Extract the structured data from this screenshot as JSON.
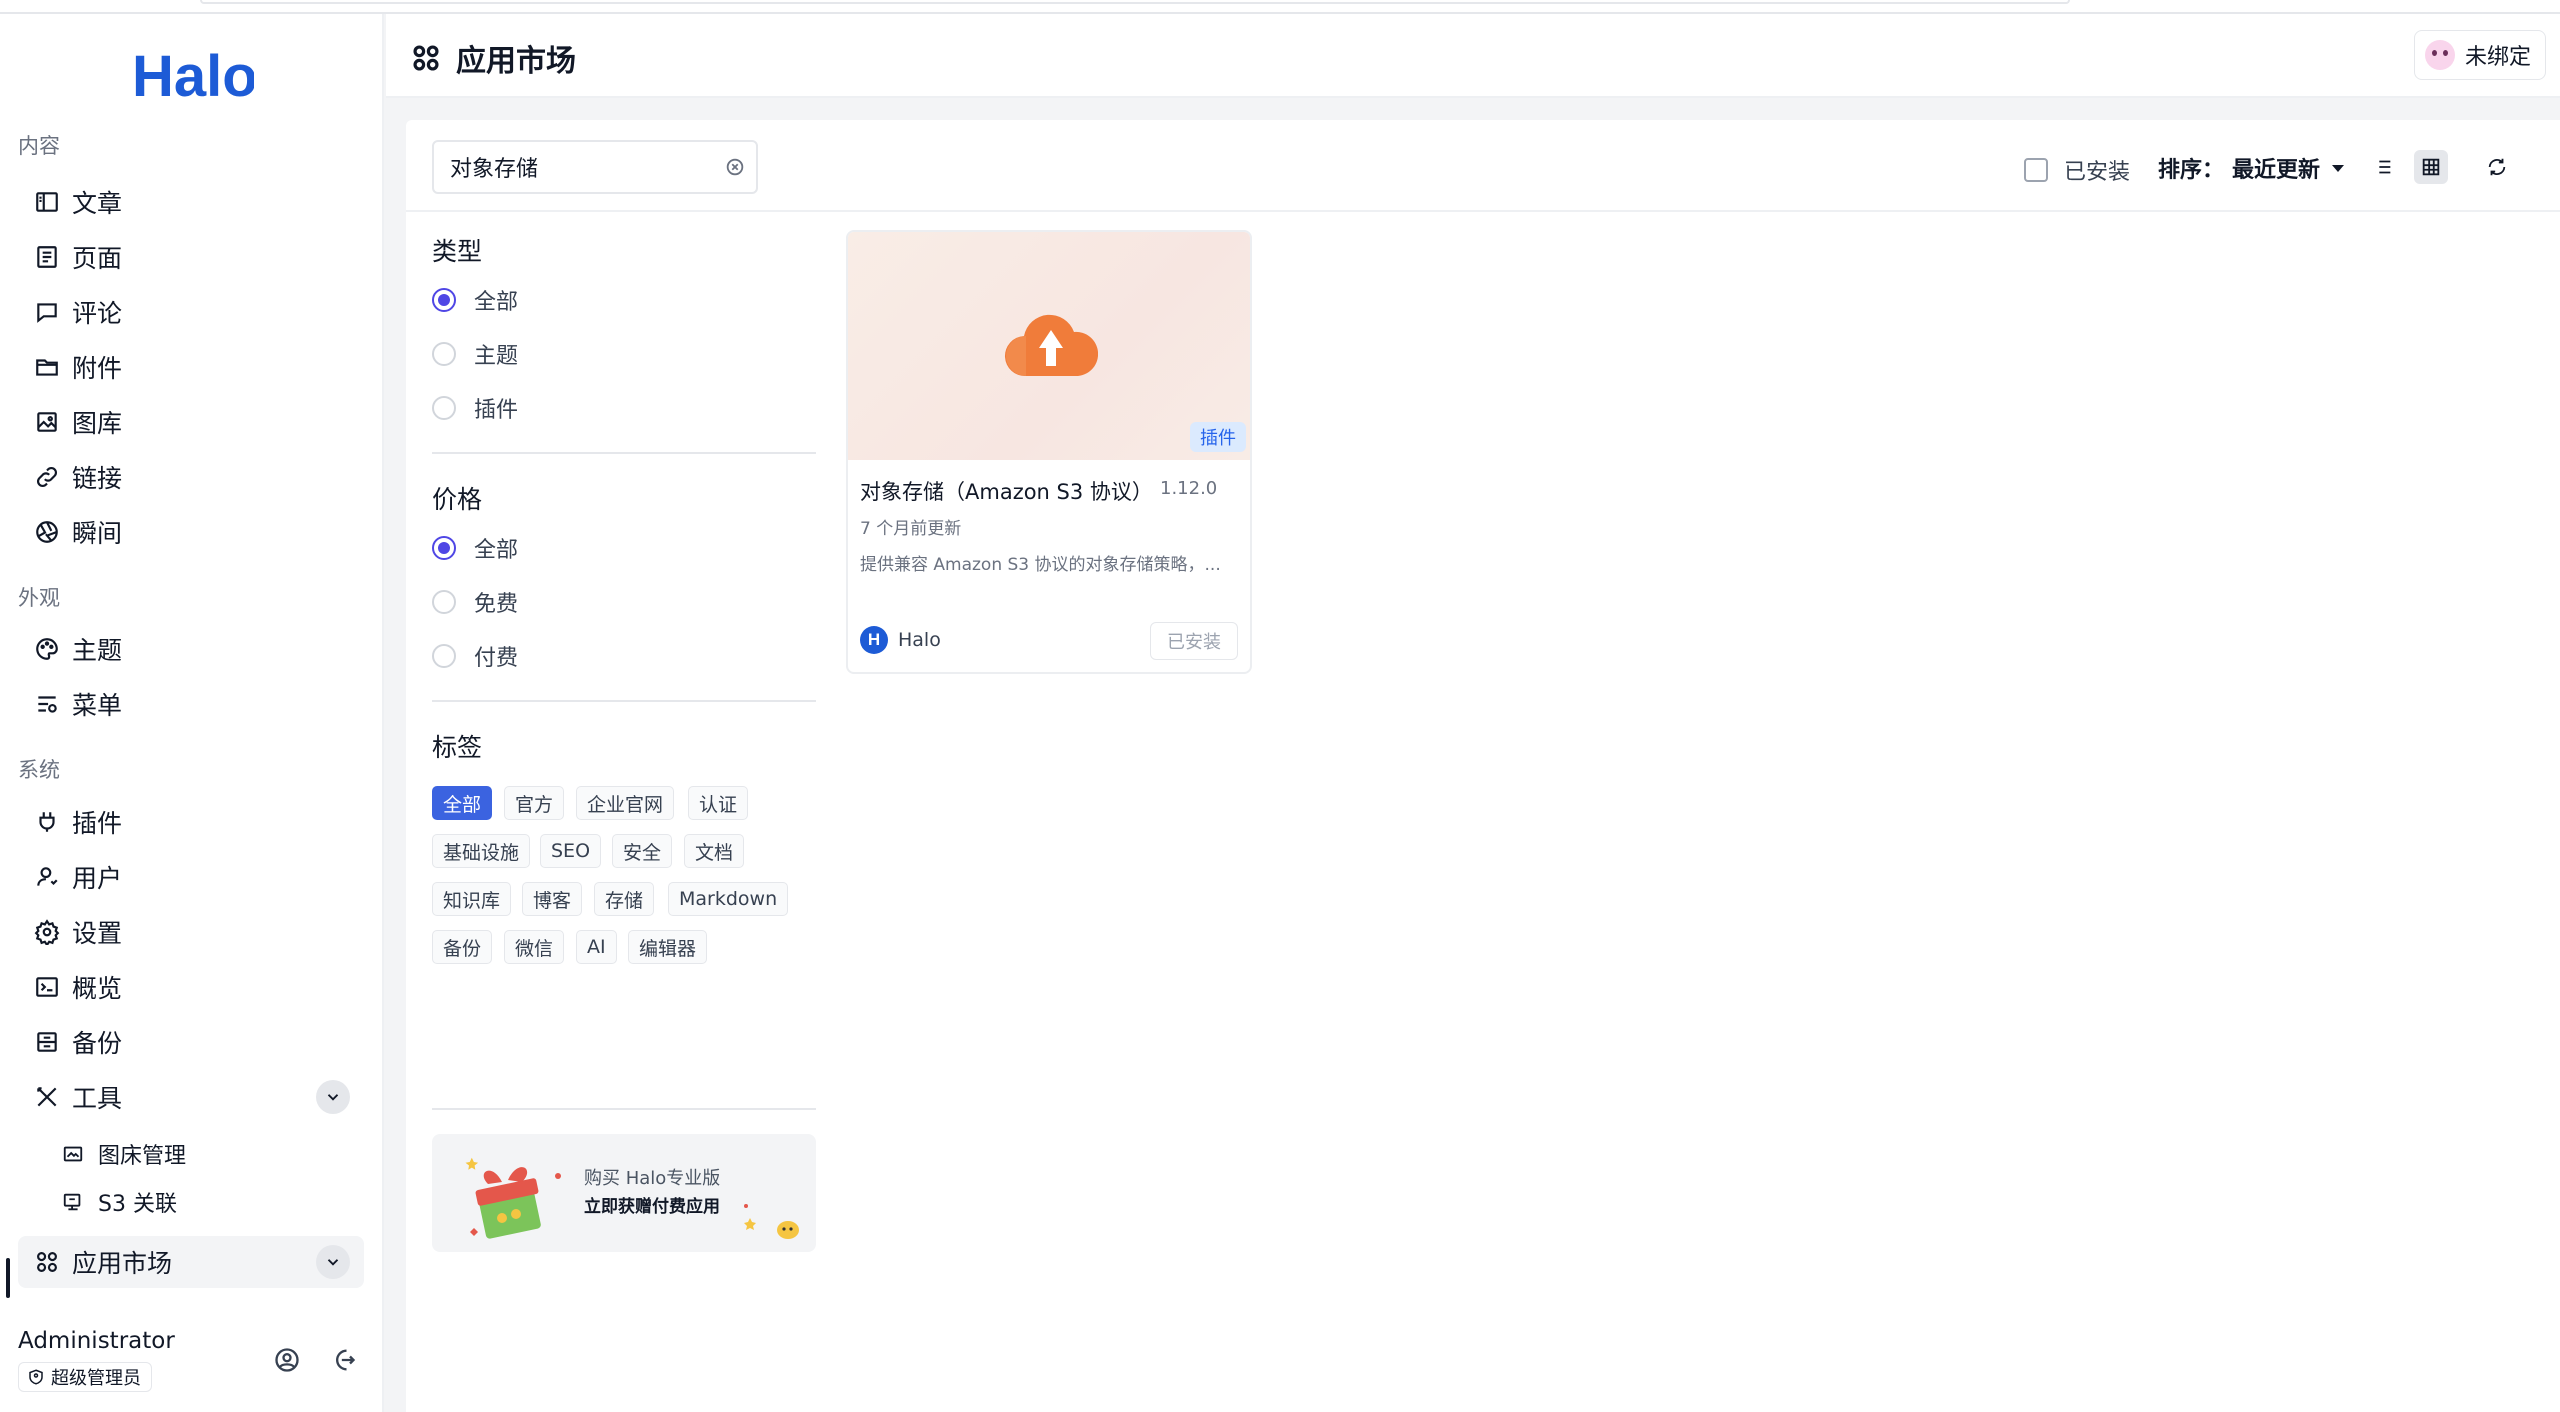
{
  "brand": {
    "logo_text": "Halo",
    "accent": "#1d5bd6"
  },
  "sidebar": {
    "sections": {
      "content": "内容",
      "appearance": "外观",
      "system": "系统"
    },
    "items": {
      "posts": "文章",
      "pages": "页面",
      "comments": "评论",
      "attachments": "附件",
      "gallery": "图库",
      "links": "链接",
      "moments": "瞬间",
      "themes": "主题",
      "menus": "菜单",
      "plugins": "插件",
      "users": "用户",
      "settings": "设置",
      "overview": "概览",
      "backup": "备份",
      "tools": "工具",
      "image_bed": "图床管理",
      "s3_link": "S3 关联",
      "app_market": "应用市场"
    },
    "user": {
      "name": "Administrator",
      "role": "超级管理员"
    }
  },
  "header": {
    "title": "应用市场",
    "bind_label": "未绑定"
  },
  "toolbar": {
    "search_value": "对象存储",
    "installed_label": "已安装",
    "sort_label": "排序：",
    "sort_value": "最近更新"
  },
  "filters": {
    "type": {
      "title": "类型",
      "options": [
        "全部",
        "主题",
        "插件"
      ],
      "selected": "全部"
    },
    "price": {
      "title": "价格",
      "options": [
        "全部",
        "免费",
        "付费"
      ],
      "selected": "全部"
    },
    "tags": {
      "title": "标签",
      "items": [
        "全部",
        "官方",
        "企业官网",
        "认证",
        "基础设施",
        "SEO",
        "安全",
        "文档",
        "知识库",
        "博客",
        "存储",
        "Markdown",
        "备份",
        "微信",
        "AI",
        "编辑器"
      ],
      "selected": "全部"
    },
    "promo": {
      "line1": "购买 Halo专业版",
      "line2": "立即获赠付费应用"
    }
  },
  "apps": [
    {
      "name": "对象存储（Amazon S3 协议）",
      "version": "1.12.0",
      "updated": "7 个月前更新",
      "description": "提供兼容 Amazon S3 协议的对象存储策略，...",
      "type_badge": "插件",
      "author": "Halo",
      "author_initial": "H",
      "action": "已安装",
      "icon_color": "#f07c3a"
    }
  ]
}
